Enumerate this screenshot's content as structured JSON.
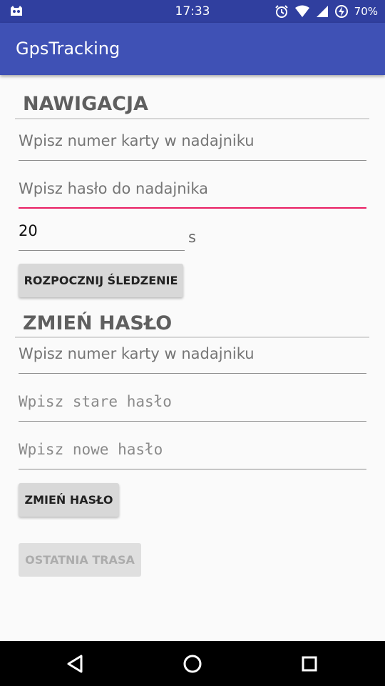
{
  "status_bar": {
    "time": "17:33",
    "battery": "70%",
    "icons": [
      "notification-app-icon",
      "alarm-icon",
      "wifi-icon",
      "signal-icon",
      "battery-charging-icon"
    ]
  },
  "app_bar": {
    "title": "GpsTracking"
  },
  "navigation": {
    "heading": "NAWIGACJA",
    "card_placeholder": "Wpisz numer karty w nadajniku",
    "password_placeholder": "Wpisz hasło do nadajnika",
    "interval_value": "20",
    "interval_unit": "s",
    "start_button": "ROZPOCZNIJ ŚLEDZENIE"
  },
  "change_password": {
    "heading": "ZMIEŃ HASŁO",
    "card_placeholder": "Wpisz numer karty w nadajniku",
    "old_password_placeholder": "Wpisz stare hasło",
    "new_password_placeholder": "Wpisz nowe hasło",
    "change_button": "ZMIEŃ HASŁO"
  },
  "last_route_button": "OSTATNIA TRASA",
  "colors": {
    "primary": "#3f51b5",
    "primary_dark": "#303f9f",
    "accent": "#e91e63"
  }
}
